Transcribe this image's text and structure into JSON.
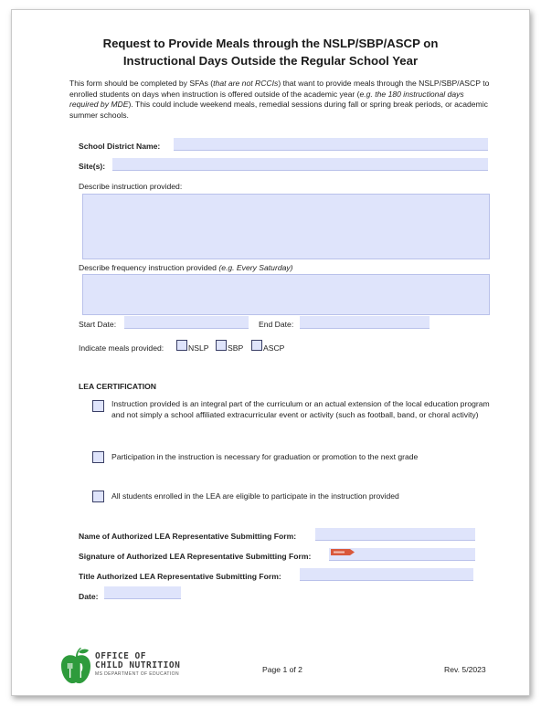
{
  "title": {
    "line1": "Request to Provide Meals through the NSLP/SBP/ASCP on",
    "line2": "Instructional Days Outside the Regular School Year"
  },
  "intro": {
    "part1": "This form should be completed by SFAs (",
    "part1_italic": "that are not RCCIs",
    "part2": ") that want to provide meals through the NSLP/SBP/ASCP to enrolled students on days when instruction is offered outside of the academic year (",
    "part2_italic": "e.g. the 180 instructional days required by MDE",
    "part3": "). This could include weekend meals, remedial sessions during fall or spring break periods, or academic summer schools."
  },
  "fields": {
    "school_district_label": "School District Name:",
    "school_district_value": "",
    "sites_label": "Site(s):",
    "sites_value": "",
    "describe_instruction_label": "Describe instruction provided:",
    "describe_instruction_value": "",
    "frequency_label": "Describe frequency instruction provided ",
    "frequency_label_italic": "(e.g. Every Saturday)",
    "frequency_value": "",
    "start_date_label": "Start Date:",
    "start_date_value": "",
    "end_date_label": "End Date:",
    "end_date_value": "",
    "meals_label": "Indicate meals provided:",
    "meals": [
      {
        "label": "NSLP",
        "checked": false
      },
      {
        "label": "SBP",
        "checked": false
      },
      {
        "label": "ASCP",
        "checked": false
      }
    ]
  },
  "certification": {
    "heading": "LEA CERTIFICATION",
    "items": [
      {
        "text": "Instruction provided is an integral part of the curriculum or an actual extension of the local education program and not simply a school affiliated extracurricular event or activity (such as football, band, or choral activity)",
        "checked": false
      },
      {
        "text": "Participation in the instruction is necessary for graduation or promotion to the next grade",
        "checked": false
      },
      {
        "text": "All students enrolled in the LEA are eligible to participate in the instruction provided",
        "checked": false
      }
    ]
  },
  "representative": {
    "name_label": "Name of Authorized LEA Representative Submitting Form:",
    "signature_label": "Signature of Authorized LEA Representative Submitting Form:",
    "title_label": "Title Authorized LEA Representative Submitting Form:",
    "date_label": "Date:"
  },
  "footer": {
    "logo_line1": "OFFICE OF",
    "logo_line2": "CHILD NUTRITION",
    "logo_sub": "MS DEPARTMENT OF EDUCATION",
    "page": "Page 1 of 2",
    "rev": "Rev. 5/2023"
  },
  "colors": {
    "field_fill": "#dfe4fb",
    "field_border": "#b9c1ea",
    "logo_green": "#2e9b3c",
    "signature_tag": "#d9583b"
  }
}
